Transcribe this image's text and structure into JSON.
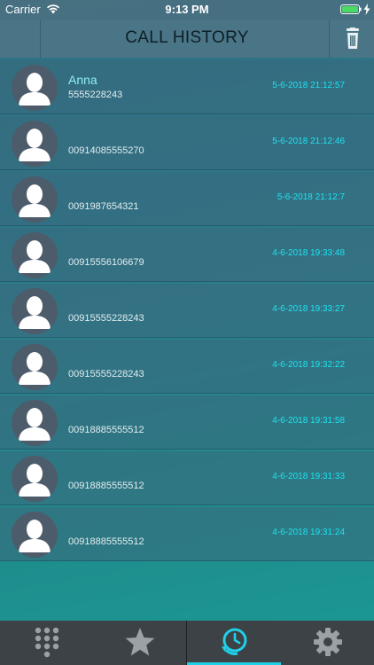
{
  "status_bar": {
    "carrier": "Carrier",
    "time": "9:13 PM"
  },
  "header": {
    "title": "CALL HISTORY",
    "delete_icon": "trash-icon"
  },
  "calls": [
    {
      "name": "Anna",
      "number": "5555228243",
      "timestamp": "5-6-2018 21:12:57"
    },
    {
      "name": "",
      "number": "00914085555270",
      "timestamp": "5-6-2018 21:12:46"
    },
    {
      "name": "",
      "number": "0091987654321",
      "timestamp": "5-6-2018 21:12:7"
    },
    {
      "name": "",
      "number": "00915556106679",
      "timestamp": "4-6-2018 19:33:48"
    },
    {
      "name": "",
      "number": "00915555228243",
      "timestamp": "4-6-2018 19:33:27"
    },
    {
      "name": "",
      "number": "00915555228243",
      "timestamp": "4-6-2018 19:32:22"
    },
    {
      "name": "",
      "number": "00918885555512",
      "timestamp": "4-6-2018 19:31:58"
    },
    {
      "name": "",
      "number": "00918885555512",
      "timestamp": "4-6-2018 19:31:33"
    },
    {
      "name": "",
      "number": "00918885555512",
      "timestamp": "4-6-2018 19:31:24"
    }
  ],
  "tab_bar": {
    "tabs": [
      {
        "id": "dialpad",
        "icon": "dialpad-icon",
        "active": false
      },
      {
        "id": "favorites",
        "icon": "star-icon",
        "active": false
      },
      {
        "id": "history",
        "icon": "history-clock-icon",
        "active": true
      },
      {
        "id": "settings",
        "icon": "gear-icon",
        "active": false
      }
    ]
  },
  "colors": {
    "accent": "#1fd0e8",
    "timestamp": "#1ee3f0",
    "contact_name": "#8ff0f0",
    "avatar_bg": "#4d5c6b",
    "tab_bar_bg": "#3c4246"
  }
}
